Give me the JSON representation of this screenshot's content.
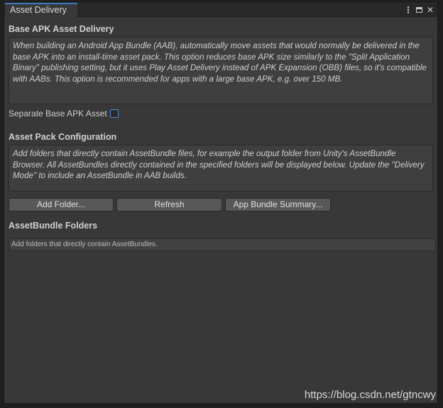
{
  "window": {
    "tab_title": "Asset Delivery",
    "controls": {
      "menu_icon": "kebab-menu-icon",
      "maximize_icon": "maximize-icon",
      "close_icon": "close-icon",
      "menu_glyph": "⋮",
      "close_glyph": "✕"
    }
  },
  "base_apk": {
    "header": "Base APK Asset Delivery",
    "help_text": "When building an Android App Bundle (AAB), automatically move assets that would normally be delivered in the base APK into an install-time asset pack. This option reduces base APK size similarly to the \"Split Application Binary\" publishing setting, but it uses Play Asset Delivery instead of APK Expansion (OBB) files, so it's compatible with AABs. This option is recommended for apps with a large base APK, e.g. over 150 MB.",
    "toggle_label": "Separate Base APK Asset",
    "toggle_checked": false
  },
  "asset_pack": {
    "header": "Asset Pack Configuration",
    "help_text": "Add folders that directly contain AssetBundle files, for example the output folder from Unity's AssetBundle Browser. All AssetBundles directly contained in the specified folders will be displayed below. Update the \"Delivery Mode\" to include an AssetBundle in AAB builds.",
    "buttons": {
      "add_folder": "Add Folder...",
      "refresh": "Refresh",
      "summary": "App Bundle Summary..."
    }
  },
  "folders": {
    "header": "AssetBundle Folders",
    "empty_text": "Add folders that directly contain AssetBundles."
  },
  "watermark": "https://blog.csdn.net/gtncwy",
  "colors": {
    "accent": "#3a79bb",
    "window_bg": "#383838",
    "button_bg": "#585858"
  }
}
